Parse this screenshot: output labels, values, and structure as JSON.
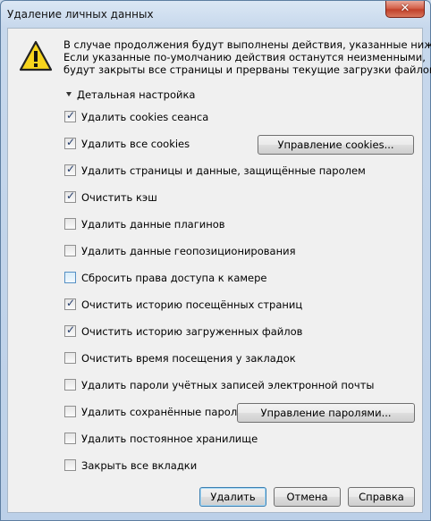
{
  "window": {
    "title": "Удаление личных данных",
    "close_glyph": "✕"
  },
  "message": {
    "lines": [
      "В случае продолжения будут выполнены действия, указанные ниже.",
      "Если указанные по-умолчанию действия останутся неизменными,",
      "будут закрыты все страницы и прерваны текущие загрузки файлов."
    ]
  },
  "details_toggle": "Детальная настройка",
  "options": [
    {
      "label": "Удалить cookies сеанса",
      "checked": true
    },
    {
      "label": "Удалить все cookies",
      "checked": true
    },
    {
      "label": "Удалить страницы и данные, защищённые паролем",
      "checked": true
    },
    {
      "label": "Очистить кэш",
      "checked": true
    },
    {
      "label": "Удалить данные плагинов",
      "checked": false
    },
    {
      "label": "Удалить данные геопозиционирования",
      "checked": false
    },
    {
      "label": "Сбросить права доступа к камере",
      "checked": false
    },
    {
      "label": "Очистить историю посещённых страниц",
      "checked": true
    },
    {
      "label": "Очистить историю загруженных файлов",
      "checked": true
    },
    {
      "label": "Очистить время посещения у закладок",
      "checked": false
    },
    {
      "label": "Удалить пароли учётных записей электронной почты",
      "checked": false
    },
    {
      "label": "Удалить сохранённые пароли",
      "checked": false
    },
    {
      "label": "Удалить постоянное хранилище",
      "checked": false
    },
    {
      "label": "Закрыть все вкладки",
      "checked": false
    }
  ],
  "buttons": {
    "manage_cookies": "Управление cookies...",
    "manage_passwords": "Управление паролями...",
    "delete": "Удалить",
    "cancel": "Отмена",
    "help": "Справка"
  },
  "icons": {
    "warning": "warning-icon",
    "checkmark": "✓"
  },
  "colors": {
    "warning_fill": "#f6d41d",
    "check_color": "#233b6a"
  }
}
